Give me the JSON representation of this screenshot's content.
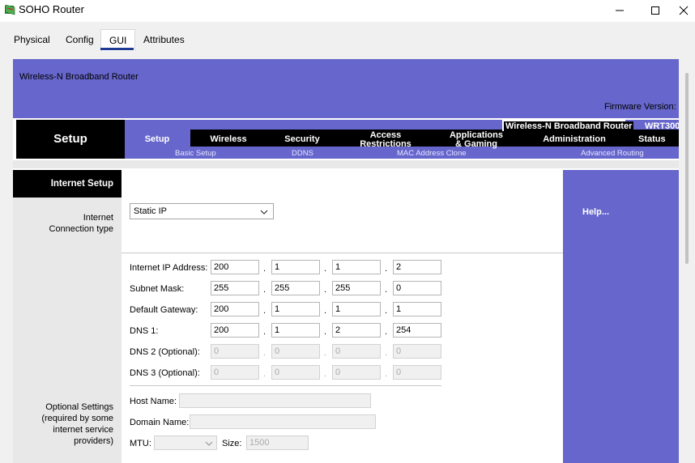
{
  "window": {
    "title": "SOHO Router",
    "minimize": "—",
    "maximize": "☐",
    "close": "✕"
  },
  "tabs": [
    {
      "label": "Physical"
    },
    {
      "label": "Config"
    },
    {
      "label": "GUI"
    },
    {
      "label": "Attributes"
    }
  ],
  "header": {
    "model": "Wireless-N Broadband Router",
    "firmware_label": "Firmware Version:",
    "product_name": "Wireless-N Broadband Router",
    "model_number": "WRT300"
  },
  "nav": {
    "section": "Setup",
    "items": [
      {
        "line1": "Setup",
        "line2": ""
      },
      {
        "line1": "Wireless",
        "line2": ""
      },
      {
        "line1": "Security",
        "line2": ""
      },
      {
        "line1": "Access",
        "line2": "Restrictions"
      },
      {
        "line1": "Applications",
        "line2": "& Gaming"
      },
      {
        "line1": "Administration",
        "line2": ""
      },
      {
        "line1": "Status",
        "line2": ""
      }
    ],
    "subitems": [
      "Basic Setup",
      "DDNS",
      "MAC Address Clone",
      "Advanced Routing"
    ]
  },
  "content": {
    "section_title": "Internet Setup",
    "connection_type_label_1": "Internet",
    "connection_type_label_2": "Connection type",
    "connection_type_value": "Static IP",
    "help": "Help...",
    "fields": {
      "ip": {
        "label": "Internet IP Address:",
        "octets": [
          "200",
          "1",
          "1",
          "2"
        ]
      },
      "mask": {
        "label": "Subnet Mask:",
        "octets": [
          "255",
          "255",
          "255",
          "0"
        ]
      },
      "gateway": {
        "label": "Default Gateway:",
        "octets": [
          "200",
          "1",
          "1",
          "1"
        ]
      },
      "dns1": {
        "label": "DNS 1:",
        "octets": [
          "200",
          "1",
          "2",
          "254"
        ]
      },
      "dns2": {
        "label": "DNS 2 (Optional):",
        "octets": [
          "0",
          "0",
          "0",
          "0"
        ]
      },
      "dns3": {
        "label": "DNS 3 (Optional):",
        "octets": [
          "0",
          "0",
          "0",
          "0"
        ]
      }
    },
    "optional": {
      "label_1": "Optional Settings",
      "label_2": "(required by some",
      "label_3": "internet service",
      "label_4": "providers)",
      "host_label": "Host Name:",
      "host_value": "",
      "domain_label": "Domain Name:",
      "domain_value": "",
      "mtu_label": "MTU:",
      "mtu_value": "",
      "size_label": "Size:",
      "size_value": "1500"
    },
    "dot": "."
  }
}
